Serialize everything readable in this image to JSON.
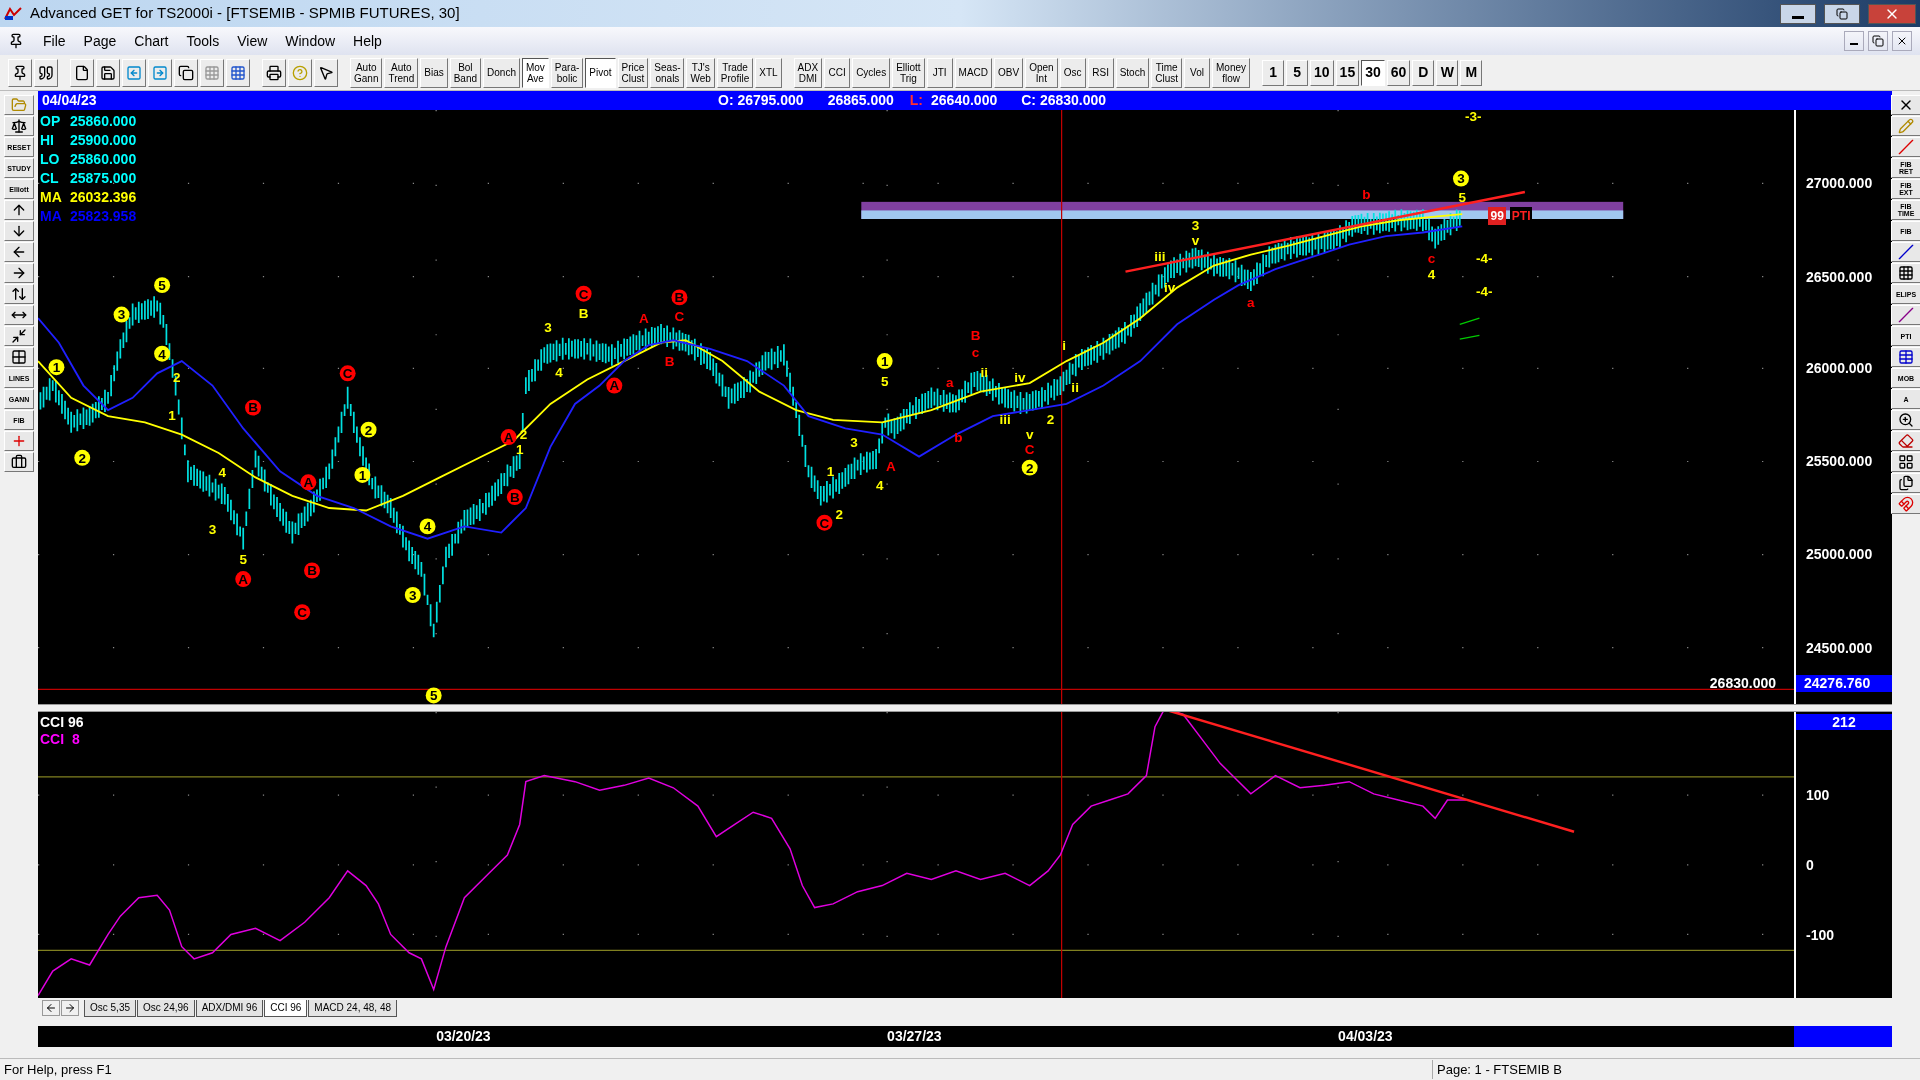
{
  "window": {
    "title": "Advanced GET for TS2000i - [FTSEMIB - SPMIB FUTURES, 30]"
  },
  "menu": [
    "File",
    "Page",
    "Chart",
    "Tools",
    "View",
    "Window",
    "Help"
  ],
  "toolbar_studies": [
    {
      "label": "Auto\nGann",
      "pressed": false
    },
    {
      "label": "Auto\nTrend",
      "pressed": false
    },
    {
      "label": "Bias",
      "pressed": false
    },
    {
      "label": "Bol\nBand",
      "pressed": false
    },
    {
      "label": "Donch",
      "pressed": false
    },
    {
      "label": "Mov\nAve",
      "pressed": true
    },
    {
      "label": "Para-\nbolic",
      "pressed": false
    },
    {
      "label": "Pivot",
      "pressed": true
    },
    {
      "label": "Price\nClust",
      "pressed": false
    },
    {
      "label": "Seas-\nonals",
      "pressed": false
    },
    {
      "label": "TJ's\nWeb",
      "pressed": false
    },
    {
      "label": "Trade\nProfile",
      "pressed": false
    },
    {
      "label": "XTL",
      "pressed": false
    }
  ],
  "toolbar_indicators": [
    {
      "label": "ADX\nDMI",
      "pressed": false
    },
    {
      "label": "CCI",
      "pressed": false
    },
    {
      "label": "Cycles",
      "pressed": false
    },
    {
      "label": "Elliott\nTrig",
      "pressed": false
    },
    {
      "label": "JTI",
      "pressed": false
    },
    {
      "label": "MACD",
      "pressed": false
    },
    {
      "label": "OBV",
      "pressed": false
    },
    {
      "label": "Open\nInt",
      "pressed": false
    },
    {
      "label": "Osc",
      "pressed": false
    },
    {
      "label": "RSI",
      "pressed": false
    },
    {
      "label": "Stoch",
      "pressed": false
    },
    {
      "label": "Time\nClust",
      "pressed": false
    },
    {
      "label": "Vol",
      "pressed": false
    },
    {
      "label": "Money\nflow",
      "pressed": false
    }
  ],
  "timeframes": [
    {
      "label": "1",
      "selected": false
    },
    {
      "label": "5",
      "selected": false
    },
    {
      "label": "10",
      "selected": false
    },
    {
      "label": "15",
      "selected": false
    },
    {
      "label": "30",
      "selected": true
    },
    {
      "label": "60",
      "selected": false
    },
    {
      "label": "D",
      "selected": false
    },
    {
      "label": "W",
      "selected": false
    },
    {
      "label": "M",
      "selected": false
    }
  ],
  "left_toolbar": [
    "RESET",
    "STUDY",
    "Elliott",
    "LINES",
    "GANN",
    "FIB"
  ],
  "right_toolbar": [
    "FIB\nRET",
    "FIB\nEXT",
    "FIB\nTIME",
    "FIB",
    "ELIPS",
    "PTI",
    "MOB",
    "A"
  ],
  "header": {
    "date": "04/04/23",
    "open": "O: 26795.000",
    "high": "26865.000",
    "low_label": "L:",
    "low": "26640.000",
    "close": "C: 26830.000"
  },
  "price_info": [
    {
      "label": "OP",
      "value": "25860.000",
      "color": "#00ffff"
    },
    {
      "label": "HI",
      "value": "25900.000",
      "color": "#00ffff"
    },
    {
      "label": "LO",
      "value": "25860.000",
      "color": "#00ffff"
    },
    {
      "label": "CL",
      "value": "25875.000",
      "color": "#00ffff"
    },
    {
      "label": "MA",
      "value": "26032.396",
      "color": "#ffff00"
    },
    {
      "label": "MA",
      "value": "25823.958",
      "color": "#0000ff"
    }
  ],
  "wave_labels": [
    {
      "text": "1",
      "kind": "circled",
      "color": "#ffff00"
    },
    {
      "text": "3",
      "kind": "circled",
      "color": "#ffff00"
    },
    {
      "text": "5",
      "kind": "circled",
      "color": "#ffff00"
    },
    {
      "text": "4",
      "kind": "circled",
      "color": "#ffff00"
    },
    {
      "text": "2",
      "kind": "circled",
      "color": "#ffff00"
    },
    {
      "text": "2",
      "kind": "circled",
      "color": "#ffff00"
    },
    {
      "text": "1",
      "kind": "circled",
      "color": "#ffff00"
    },
    {
      "text": "4",
      "kind": "circled",
      "color": "#ffff00"
    },
    {
      "text": "3",
      "kind": "circled",
      "color": "#ffff00"
    },
    {
      "text": "5",
      "kind": "circled",
      "color": "#ffff00"
    },
    {
      "text": "1",
      "kind": "circled",
      "color": "#ffff00"
    },
    {
      "text": "2",
      "kind": "circled",
      "color": "#ffff00"
    },
    {
      "text": "3",
      "kind": "circled",
      "color": "#ffff00"
    },
    {
      "text": "2",
      "kind": "plain",
      "color": "#ffff00"
    },
    {
      "text": "1",
      "kind": "plain",
      "color": "#ffff00"
    },
    {
      "text": "4",
      "kind": "plain",
      "color": "#ffff00"
    },
    {
      "text": "3",
      "kind": "plain",
      "color": "#ffff00"
    },
    {
      "text": "5",
      "kind": "plain",
      "color": "#ffff00"
    },
    {
      "text": "3",
      "kind": "plain",
      "color": "#ffff00"
    },
    {
      "text": "B",
      "kind": "plain",
      "color": "#ffff00"
    },
    {
      "text": "4",
      "kind": "plain",
      "color": "#ffff00"
    },
    {
      "text": "2",
      "kind": "plain",
      "color": "#ffff00"
    },
    {
      "text": "1",
      "kind": "plain",
      "color": "#ffff00"
    },
    {
      "text": "5",
      "kind": "plain",
      "color": "#ffff00"
    },
    {
      "text": "3",
      "kind": "plain",
      "color": "#ffff00"
    },
    {
      "text": "1",
      "kind": "plain",
      "color": "#ffff00"
    },
    {
      "text": "2",
      "kind": "plain",
      "color": "#ffff00"
    },
    {
      "text": "4",
      "kind": "plain",
      "color": "#ffff00"
    },
    {
      "text": "iii",
      "kind": "plain",
      "color": "#ffff00"
    },
    {
      "text": "iv",
      "kind": "plain",
      "color": "#ffff00"
    },
    {
      "text": "3",
      "kind": "plain",
      "color": "#ffff00"
    },
    {
      "text": "v",
      "kind": "plain",
      "color": "#ffff00"
    },
    {
      "text": "5",
      "kind": "plain",
      "color": "#ffff00"
    },
    {
      "text": "4",
      "kind": "plain",
      "color": "#ffff00"
    },
    {
      "text": "ii",
      "kind": "plain",
      "color": "#ffff00"
    },
    {
      "text": "iv",
      "kind": "plain",
      "color": "#ffff00"
    },
    {
      "text": "i",
      "kind": "plain",
      "color": "#ffff00"
    },
    {
      "text": "ii",
      "kind": "plain",
      "color": "#ffff00"
    },
    {
      "text": "iii",
      "kind": "plain",
      "color": "#ffff00"
    },
    {
      "text": "v",
      "kind": "plain",
      "color": "#ffff00"
    },
    {
      "text": "2",
      "kind": "plain",
      "color": "#ffff00"
    },
    {
      "text": "-3-",
      "kind": "plain",
      "color": "#ffff00"
    },
    {
      "text": "-4-",
      "kind": "plain",
      "color": "#ffff00"
    },
    {
      "text": "-4-",
      "kind": "plain",
      "color": "#ffff00"
    },
    {
      "text": "C",
      "kind": "circled",
      "color": "#ff0000"
    },
    {
      "text": "B",
      "kind": "circled",
      "color": "#ff0000"
    },
    {
      "text": "A",
      "kind": "circled",
      "color": "#ff0000"
    },
    {
      "text": "A",
      "kind": "circled",
      "color": "#ff0000"
    },
    {
      "text": "B",
      "kind": "circled",
      "color": "#ff0000"
    },
    {
      "text": "C",
      "kind": "circled",
      "color": "#ff0000"
    },
    {
      "text": "A",
      "kind": "circled",
      "color": "#ff0000"
    },
    {
      "text": "B",
      "kind": "circled",
      "color": "#ff0000"
    },
    {
      "text": "C",
      "kind": "circled",
      "color": "#ff0000"
    },
    {
      "text": "B",
      "kind": "circled",
      "color": "#ff0000"
    },
    {
      "text": "A",
      "kind": "circled",
      "color": "#ff0000"
    },
    {
      "text": "C",
      "kind": "circled",
      "color": "#ff0000"
    },
    {
      "text": "A",
      "kind": "plain",
      "color": "#ff0000"
    },
    {
      "text": "C",
      "kind": "plain",
      "color": "#ff0000"
    },
    {
      "text": "B",
      "kind": "plain",
      "color": "#ff0000"
    },
    {
      "text": "B",
      "kind": "plain",
      "color": "#ff0000"
    },
    {
      "text": "c",
      "kind": "plain",
      "color": "#ff0000"
    },
    {
      "text": "a",
      "kind": "plain",
      "color": "#ff0000"
    },
    {
      "text": "b",
      "kind": "plain",
      "color": "#ff0000"
    },
    {
      "text": "C",
      "kind": "plain",
      "color": "#ff0000"
    },
    {
      "text": "A",
      "kind": "plain",
      "color": "#ff0000"
    },
    {
      "text": "a",
      "kind": "plain",
      "color": "#ff0000"
    },
    {
      "text": "b",
      "kind": "plain",
      "color": "#ff0000"
    },
    {
      "text": "c",
      "kind": "plain",
      "color": "#ff0000"
    }
  ],
  "pti": {
    "value": "99",
    "label": "PTI"
  },
  "last_close": "26830.000",
  "price_axis": {
    "labels": [
      "27000.000",
      "26500.000",
      "26000.000",
      "25500.000",
      "25000.000",
      "24500.000"
    ],
    "current": "24276.760"
  },
  "cci_pane": {
    "legend": [
      {
        "text": "CCI 96",
        "color": "#ffffff"
      },
      {
        "text": "CCI  8",
        "color": "#ff00ff"
      }
    ],
    "current": "212",
    "labels": [
      "100",
      "0",
      "-100"
    ]
  },
  "tabs": [
    {
      "label": "Osc 5,35",
      "selected": false
    },
    {
      "label": "Osc 24,96",
      "selected": false
    },
    {
      "label": "ADX/DMI 96",
      "selected": false
    },
    {
      "label": "CCI 96",
      "selected": true
    },
    {
      "label": "MACD 24, 48, 48",
      "selected": false
    }
  ],
  "dates": [
    "03/20/23",
    "03/27/23",
    "04/03/23"
  ],
  "status_bar": {
    "help": "For Help, press F1",
    "page": "Page: 1 - FTSEMIB B"
  }
}
